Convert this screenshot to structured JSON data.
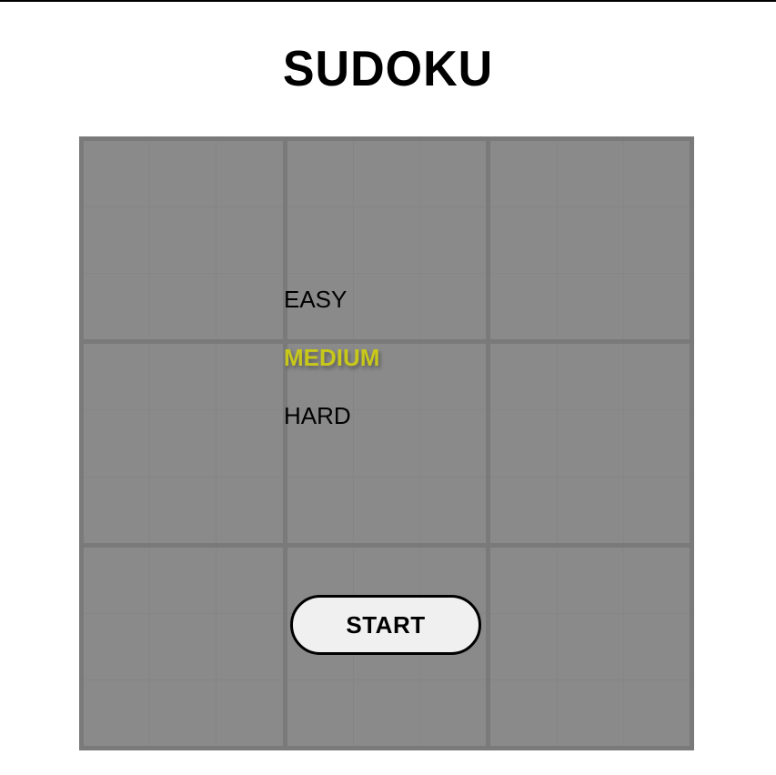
{
  "title": "SUDOKU",
  "difficulty": {
    "options": [
      "EASY",
      "MEDIUM",
      "HARD"
    ],
    "selected": "MEDIUM"
  },
  "start_label": "START",
  "colors": {
    "board": "#8a8a8a",
    "selected_option": "#c8c81a",
    "button_background": "#f0f0f0"
  }
}
